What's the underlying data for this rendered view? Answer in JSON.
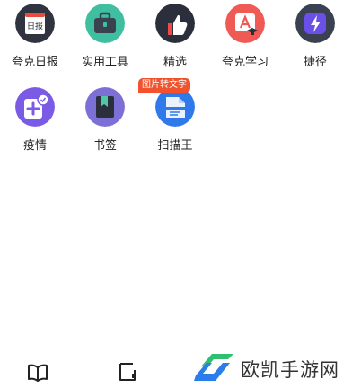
{
  "apps": {
    "row1": [
      {
        "label": "夸克日报",
        "icon": "daily-report-icon"
      },
      {
        "label": "实用工具",
        "icon": "toolbox-icon"
      },
      {
        "label": "精选",
        "icon": "thumbs-up-icon"
      },
      {
        "label": "夸克学习",
        "icon": "study-icon"
      },
      {
        "label": "捷径",
        "icon": "shortcut-icon"
      }
    ],
    "row2": [
      {
        "label": "疫情",
        "icon": "epidemic-icon"
      },
      {
        "label": "书签",
        "icon": "bookmark-icon"
      },
      {
        "label": "扫描王",
        "icon": "scanner-icon",
        "badge": "图片转文字"
      }
    ]
  },
  "daily_icon_text": "日报",
  "bottom_bar": {
    "book_icon": "book-icon",
    "tab_icon": "tab-icon"
  },
  "watermark": {
    "text": "欧凯手游网"
  },
  "colors": {
    "badge": "#f0532e",
    "toolbox": "#3fbfa0",
    "thumbs": "#2b2f3b",
    "study": "#ef5a55",
    "shortcut": "#6a50e8",
    "epidemic": "#7b5be6",
    "bookmark": "#7c6fd6",
    "scanner": "#2f79ea",
    "watermark_green": "#2fbf71",
    "watermark_blue": "#2b7de9"
  }
}
